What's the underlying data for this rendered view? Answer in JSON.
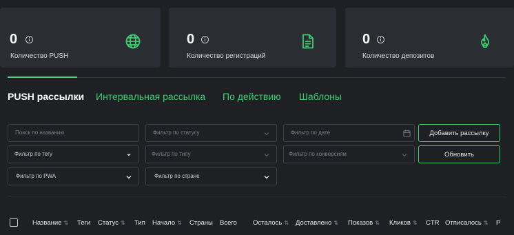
{
  "stats": [
    {
      "value": "0",
      "caption": "Количество PUSH",
      "icon": "globe-icon"
    },
    {
      "value": "0",
      "caption": "Количество регистраций",
      "icon": "document-icon"
    },
    {
      "value": "0",
      "caption": "Количество депозитов",
      "icon": "flame-icon"
    }
  ],
  "colors": {
    "accent": "#3fcf72",
    "background": "#1e2024",
    "card": "#2a2d32"
  },
  "tabs": [
    {
      "label": "PUSH рассылки",
      "active": true
    },
    {
      "label": "Интервальная рассылка",
      "active": false
    },
    {
      "label": "По действию",
      "active": false
    },
    {
      "label": "Шаблоны",
      "active": false
    }
  ],
  "filters": {
    "search_placeholder": "Поиск по названию",
    "status_placeholder": "Фильтр по статусу",
    "date_placeholder": "Фильтр по дате",
    "tag_placeholder": "Фильтр по тегу",
    "type_placeholder": "Фильтр по типу",
    "conversion_placeholder": "Фильтр по конверсиям",
    "pwa_placeholder": "Фильтр по PWA",
    "country_placeholder": "Фильтр по стране"
  },
  "buttons": {
    "add": "Добавить рассылку",
    "refresh": "Обновить"
  },
  "table": {
    "columns": [
      {
        "label": "Название",
        "sortable": true
      },
      {
        "label": "Теги",
        "sortable": false
      },
      {
        "label": "Статус",
        "sortable": true
      },
      {
        "label": "Тип",
        "sortable": false
      },
      {
        "label": "Начало",
        "sortable": true
      },
      {
        "label": "Страны",
        "sortable": false
      },
      {
        "label": "Всего",
        "sortable": false
      },
      {
        "label": "Осталось",
        "sortable": true
      },
      {
        "label": "Доставлено",
        "sortable": true
      },
      {
        "label": "Показов",
        "sortable": true
      },
      {
        "label": "Кликов",
        "sortable": true
      },
      {
        "label": "CTR",
        "sortable": false
      },
      {
        "label": "Отписалось",
        "sortable": true
      },
      {
        "label": "Р",
        "sortable": false
      }
    ]
  }
}
